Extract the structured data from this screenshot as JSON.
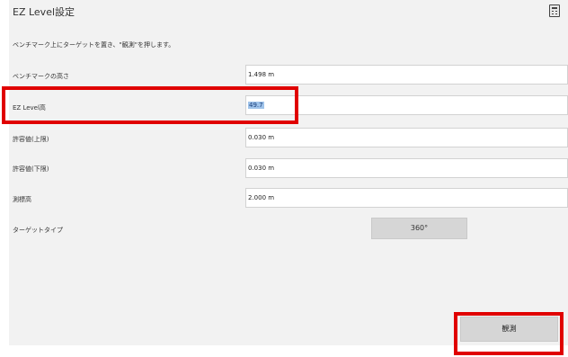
{
  "window": {
    "title": "EZ Level設定",
    "header_icon": "calculator-icon"
  },
  "instruction": "ベンチマーク上にターゲットを置き、\"観測\"を押します。",
  "fields": [
    {
      "label": "ベンチマークの高さ",
      "value": "1.498 m"
    },
    {
      "label": "EZ Level高",
      "value": "49.7"
    },
    {
      "label": "許容値(上限)",
      "value": "0.030 m"
    },
    {
      "label": "許容値(下限)",
      "value": "0.030 m"
    },
    {
      "label": "測標高",
      "value": "2.000 m"
    }
  ],
  "target_type": {
    "label": "ターゲットタイプ",
    "value": "360°"
  },
  "actions": {
    "measure_label": "観測"
  },
  "highlight_color": "#e00000",
  "selection_color": "#9fc3ea"
}
